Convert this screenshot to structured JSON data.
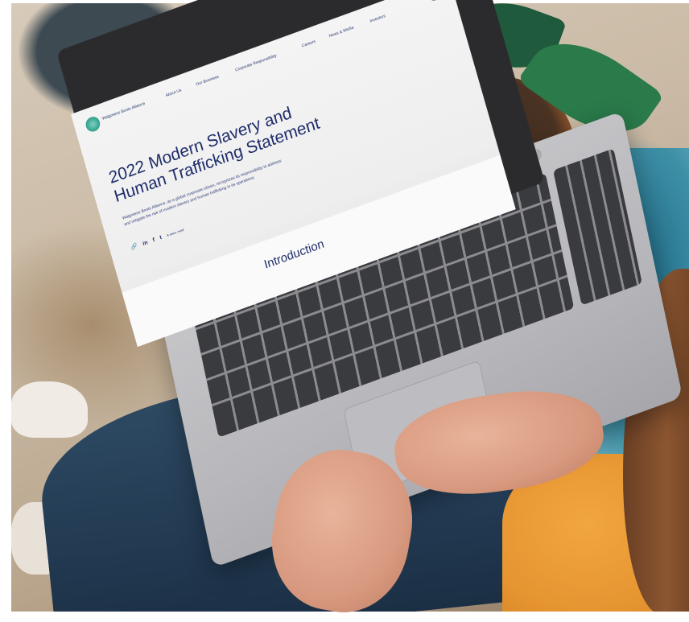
{
  "scene": {
    "description_elements": [
      "laptop",
      "plant",
      "chair",
      "person"
    ]
  },
  "website": {
    "brand": "Walgreens Boots Alliance",
    "nav": [
      "About Us",
      "Our Business",
      "Corporate Responsibility",
      "Careers",
      "News & Media",
      "Investors"
    ],
    "title_line1": "2022 Modern Slavery and",
    "title_line2": "Human Trafficking Statement",
    "description": "Walgreens Boots Alliance, as a global corporate citizen, recognizes its responsibility to address and mitigate the risk of modern slavery and human trafficking in its operations.",
    "social": {
      "link": "🔗",
      "linkedin": "in",
      "facebook": "f",
      "twitter": "t",
      "readtime": "8 mins read"
    },
    "section_heading": "Introduction"
  }
}
